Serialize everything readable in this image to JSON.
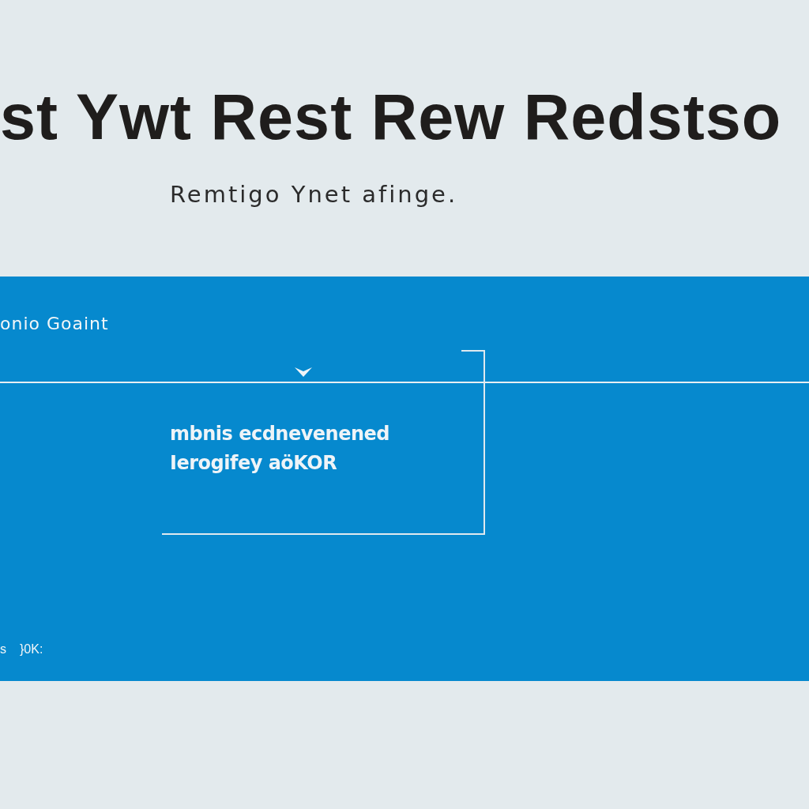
{
  "header": {
    "title": "st Ywt Rest Rew Redstso",
    "subtitle": "Remtigo Ynet afinge."
  },
  "panel": {
    "label": "onio Goaint",
    "select": {
      "expanded": true,
      "menu_lines": [
        "mbnis ecdnevenened",
        "Ierogifey aöKOR"
      ]
    },
    "footer": [
      "s",
      "}0K:"
    ]
  }
}
